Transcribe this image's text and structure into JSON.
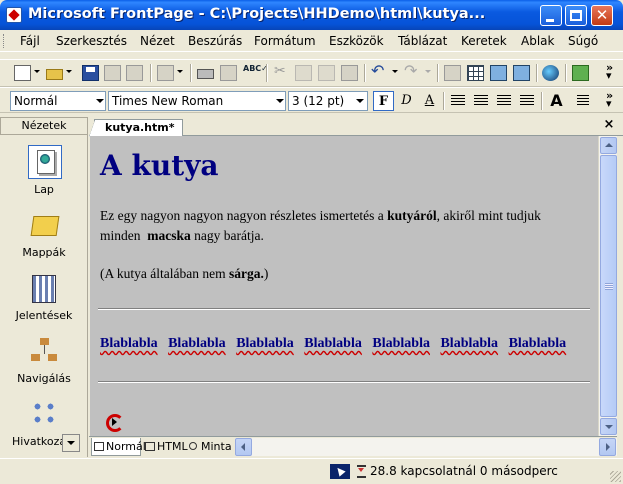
{
  "window": {
    "title": "Microsoft FrontPage - C:\\Projects\\HHDemo\\html\\kutya...",
    "close_glyph": "✕"
  },
  "menu": {
    "items": [
      {
        "label": "Fájl"
      },
      {
        "label": "Szerkesztés"
      },
      {
        "label": "Nézet"
      },
      {
        "label": "Beszúrás"
      },
      {
        "label": "Formátum"
      },
      {
        "label": "Eszközök"
      },
      {
        "label": "Táblázat"
      },
      {
        "label": "Keretek"
      },
      {
        "label": "Ablak"
      },
      {
        "label": "Súgó"
      }
    ]
  },
  "formatting": {
    "style": "Normál",
    "font": "Times New Roman",
    "size": "3  (12 pt)",
    "bold": "F",
    "italic": "D",
    "underline": "A",
    "grow_font": "A"
  },
  "views": {
    "header": "Nézetek",
    "items": [
      {
        "label": "Lap",
        "icon": "page-view-icon",
        "active": true
      },
      {
        "label": "Mappák",
        "icon": "folders-view-icon",
        "active": false
      },
      {
        "label": "Jelentések",
        "icon": "reports-view-icon",
        "active": false
      },
      {
        "label": "Navigálás",
        "icon": "navigation-view-icon",
        "active": false
      },
      {
        "label": "Hivatkozá",
        "icon": "hyperlinks-view-icon",
        "active": false
      }
    ]
  },
  "document": {
    "tab_label": "kutya.htm*",
    "close_glyph": "×",
    "heading": "A kutya",
    "para1_a": "Ez egy nagyon nagyon nagyon részletes ismertetés a ",
    "para1_bold": "kutyáról",
    "para1_b": ", akiről mint tudjuk",
    "para1_c": "minden  ",
    "para1_bold2": "macska",
    "para1_d": " nagy barátja.",
    "para2_a": "(A kutya általában nem ",
    "para2_bold": "sárga.",
    "para2_b": ")",
    "links": [
      "Blablabla",
      "Blablabla",
      "Blablabla",
      "Blablabla",
      "Blablabla",
      "Blablabla",
      "Blablabla"
    ],
    "background_color": "#c0c0c0",
    "heading_color": "#000080"
  },
  "view_tabs": [
    {
      "label": "Normál",
      "active": true
    },
    {
      "label": "HTML",
      "active": false
    },
    {
      "label": "Minta",
      "active": false
    }
  ],
  "status": {
    "text": "28.8 kapcsolatnál 0 másodperc"
  },
  "colors": {
    "titlebar": "#0a5ae0",
    "chrome": "#ece9d8",
    "link": "#000080"
  }
}
